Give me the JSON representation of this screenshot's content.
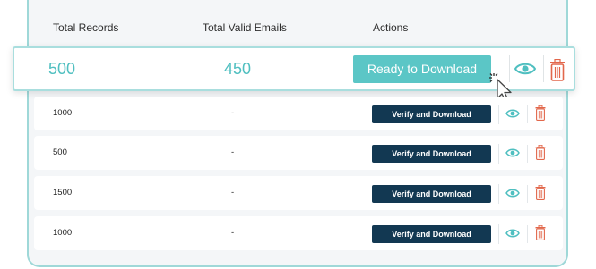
{
  "header": {
    "col1": "Total Records",
    "col2": "Total Valid Emails",
    "col3": "Actions"
  },
  "highlight": {
    "records": "500",
    "valid": "450",
    "action_label": "Ready to Download"
  },
  "rows": [
    {
      "records": "1000",
      "valid": "-",
      "action_label": "Verify and Download"
    },
    {
      "records": "500",
      "valid": "-",
      "action_label": "Verify and Download"
    },
    {
      "records": "1500",
      "valid": "-",
      "action_label": "Verify and Download"
    },
    {
      "records": "1000",
      "valid": "-",
      "action_label": "Verify and Download"
    }
  ],
  "colors": {
    "accent": "#5bc6c6",
    "dark_button": "#123852",
    "trash": "#e2674b",
    "eye": "#4fbfc0",
    "border": "#9fd8d8"
  },
  "icons": {
    "view": "eye-icon",
    "delete": "trash-icon",
    "pointer": "cursor-icon"
  }
}
